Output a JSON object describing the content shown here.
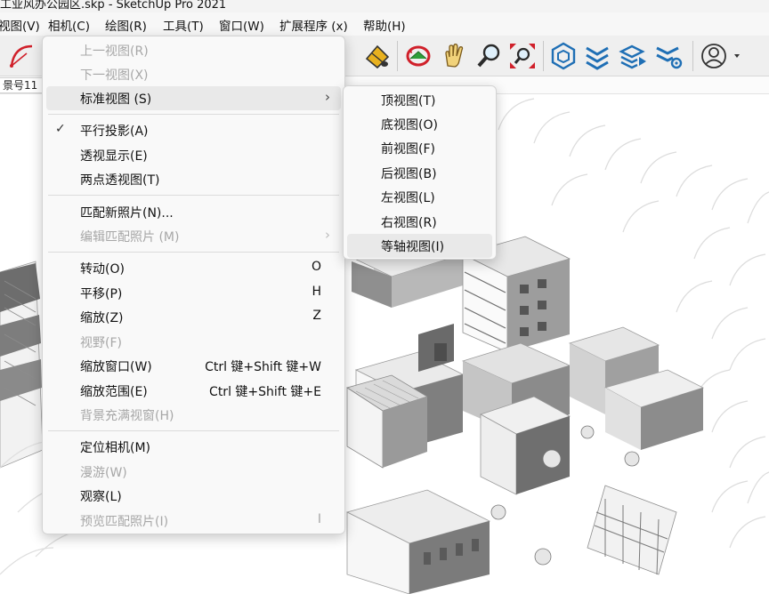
{
  "window": {
    "title": "工业风办公园区.skp - SketchUp Pro 2021"
  },
  "menubar": {
    "items": [
      {
        "label": "视图(V)"
      },
      {
        "label": "相机(C)"
      },
      {
        "label": "绘图(R)"
      },
      {
        "label": "工具(T)"
      },
      {
        "label": "窗口(W)"
      },
      {
        "label": "扩展程序 (x)"
      },
      {
        "label": "帮助(H)"
      }
    ]
  },
  "toolbar": {
    "icons": [
      "arc-tool-icon",
      "section-display-icon",
      "paint-bucket-icon",
      "orbit-icon",
      "pan-icon",
      "zoom-icon",
      "zoom-extents-icon",
      "extension-warehouse-icon",
      "components-icon",
      "layout-send-icon",
      "extension-manager-icon",
      "account-icon"
    ]
  },
  "scene_tab": {
    "label": "景号11"
  },
  "camera_menu": {
    "items": [
      {
        "label": "上一视图(R)",
        "enabled": false
      },
      {
        "label": "下一视图(X)",
        "enabled": false
      },
      {
        "label": "标准视图 (S)",
        "enabled": true,
        "submenu": true,
        "highlighted": true
      },
      {
        "label": "平行投影(A)",
        "enabled": true,
        "checked": true
      },
      {
        "label": "透视显示(E)",
        "enabled": true
      },
      {
        "label": "两点透视图(T)",
        "enabled": true
      },
      {
        "label": "匹配新照片(N)...",
        "enabled": true
      },
      {
        "label": "编辑匹配照片 (M)",
        "enabled": false,
        "submenu": true
      },
      {
        "label": "转动(O)",
        "enabled": true,
        "shortcut": "O"
      },
      {
        "label": "平移(P)",
        "enabled": true,
        "shortcut": "H"
      },
      {
        "label": "缩放(Z)",
        "enabled": true,
        "shortcut": "Z"
      },
      {
        "label": "视野(F)",
        "enabled": false
      },
      {
        "label": "缩放窗口(W)",
        "enabled": true,
        "shortcut": "Ctrl 键+Shift 键+W"
      },
      {
        "label": "缩放范围(E)",
        "enabled": true,
        "shortcut": "Ctrl 键+Shift 键+E"
      },
      {
        "label": "背景充满视窗(H)",
        "enabled": false
      },
      {
        "label": "定位相机(M)",
        "enabled": true
      },
      {
        "label": "漫游(W)",
        "enabled": false
      },
      {
        "label": "观察(L)",
        "enabled": true
      },
      {
        "label": "预览匹配照片(I)",
        "enabled": false,
        "shortcut": "I"
      }
    ]
  },
  "standard_views_submenu": {
    "items": [
      {
        "label": "顶视图(T)"
      },
      {
        "label": "底视图(O)"
      },
      {
        "label": "前视图(F)"
      },
      {
        "label": "后视图(B)"
      },
      {
        "label": "左视图(L)"
      },
      {
        "label": "右视图(R)"
      },
      {
        "label": "等轴视图(I)",
        "highlighted": true
      }
    ]
  },
  "colors": {
    "menu_bg": "#f9f9f9",
    "highlight": "#e9e9e9",
    "disabled_text": "#a7a7a7",
    "accent_blue": "#1f6fb5"
  }
}
